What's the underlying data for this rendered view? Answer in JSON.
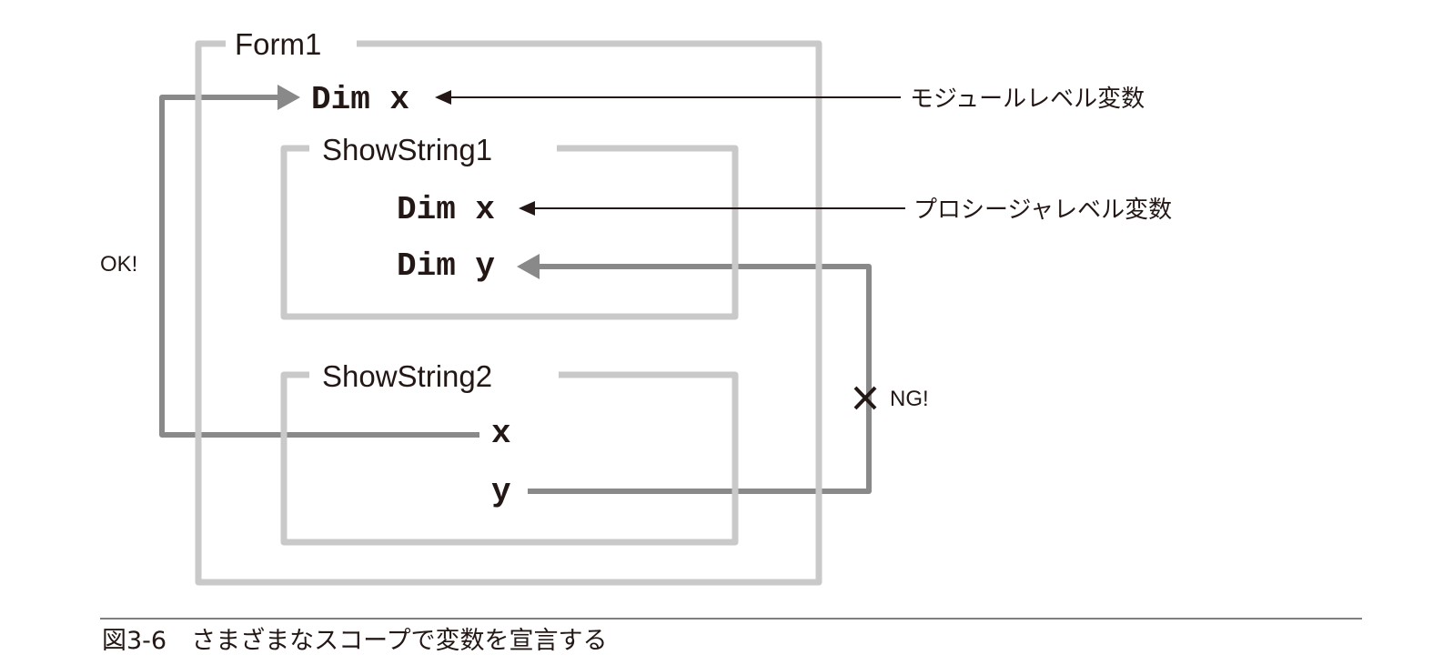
{
  "scopes": {
    "form": "Form1",
    "proc1": "ShowString1",
    "proc2": "ShowString2"
  },
  "code": {
    "module_dim_x": "Dim x",
    "proc1_dim_x": "Dim x",
    "proc1_dim_y": "Dim y",
    "proc2_x": "x",
    "proc2_y": "y"
  },
  "annotations": {
    "module_level": "モジュールレベル変数",
    "procedure_level": "プロシージャレベル変数",
    "ok": "OK!",
    "ng": "NG!"
  },
  "caption": "図3-6　さまざまなスコープで変数を宣言する",
  "colors": {
    "scope_box": "#c9c9c9",
    "reference_arrow": "#898989",
    "text": "#231815"
  }
}
